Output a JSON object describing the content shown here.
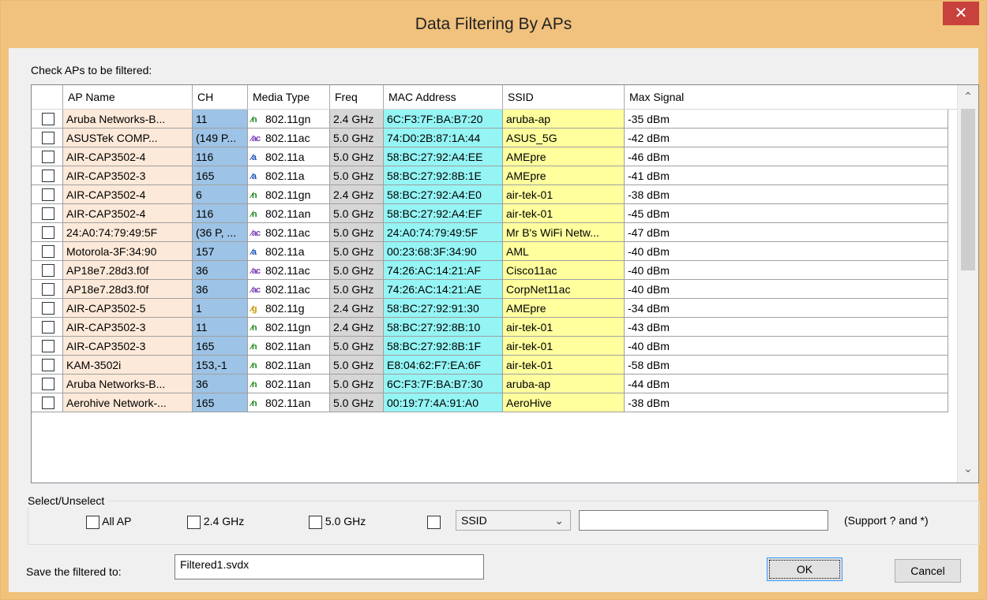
{
  "window": {
    "title": "Data Filtering By APs",
    "close_label": "✕"
  },
  "instructions": "Check APs to be filtered:",
  "columns": [
    "AP Name",
    "CH",
    "Media Type",
    "Freq",
    "MAC Address",
    "SSID",
    "Max Signal"
  ],
  "rows": [
    {
      "name": "Aruba Networks-B...",
      "ch": "11",
      "icon": "n",
      "media": "802.11gn",
      "freq": "2.4 GHz",
      "mac": "6C:F3:7F:BA:B7:20",
      "ssid": "aruba-ap",
      "max": "-35 dBm"
    },
    {
      "name": "ASUSTek COMP...",
      "ch": "(149 P...",
      "icon": "ac",
      "media": "802.11ac",
      "freq": "5.0 GHz",
      "mac": "74:D0:2B:87:1A:44",
      "ssid": "ASUS_5G",
      "max": "-42 dBm"
    },
    {
      "name": "AIR-CAP3502-4",
      "ch": "116",
      "icon": "a",
      "media": "802.11a",
      "freq": "5.0 GHz",
      "mac": "58:BC:27:92:A4:EE",
      "ssid": "AMEpre",
      "max": "-46 dBm"
    },
    {
      "name": "AIR-CAP3502-3",
      "ch": "165",
      "icon": "a",
      "media": "802.11a",
      "freq": "5.0 GHz",
      "mac": "58:BC:27:92:8B:1E",
      "ssid": "AMEpre",
      "max": "-41 dBm"
    },
    {
      "name": "AIR-CAP3502-4",
      "ch": "6",
      "icon": "n",
      "media": "802.11gn",
      "freq": "2.4 GHz",
      "mac": "58:BC:27:92:A4:E0",
      "ssid": "air-tek-01",
      "max": "-38 dBm"
    },
    {
      "name": "AIR-CAP3502-4",
      "ch": "116",
      "icon": "n",
      "media": "802.11an",
      "freq": "5.0 GHz",
      "mac": "58:BC:27:92:A4:EF",
      "ssid": "air-tek-01",
      "max": "-45 dBm"
    },
    {
      "name": "24:A0:74:79:49:5F",
      "ch": "(36 P, ...",
      "icon": "ac",
      "media": "802.11ac",
      "freq": "5.0 GHz",
      "mac": "24:A0:74:79:49:5F",
      "ssid": "Mr B's WiFi Netw...",
      "max": "-47 dBm"
    },
    {
      "name": "Motorola-3F:34:90",
      "ch": "157",
      "icon": "a",
      "media": "802.11a",
      "freq": "5.0 GHz",
      "mac": "00:23:68:3F:34:90",
      "ssid": "AML",
      "max": "-40 dBm"
    },
    {
      "name": "AP18e7.28d3.f0f",
      "ch": "36",
      "icon": "ac",
      "media": "802.11ac",
      "freq": "5.0 GHz",
      "mac": "74:26:AC:14:21:AF",
      "ssid": "Cisco11ac",
      "max": "-40 dBm"
    },
    {
      "name": "AP18e7.28d3.f0f",
      "ch": "36",
      "icon": "ac",
      "media": "802.11ac",
      "freq": "5.0 GHz",
      "mac": "74:26:AC:14:21:AE",
      "ssid": "CorpNet11ac",
      "max": "-40 dBm"
    },
    {
      "name": "AIR-CAP3502-5",
      "ch": "1",
      "icon": "g",
      "media": "802.11g",
      "freq": "2.4 GHz",
      "mac": "58:BC:27:92:91:30",
      "ssid": "AMEpre",
      "max": "-34 dBm"
    },
    {
      "name": "AIR-CAP3502-3",
      "ch": "11",
      "icon": "n",
      "media": "802.11gn",
      "freq": "2.4 GHz",
      "mac": "58:BC:27:92:8B:10",
      "ssid": "air-tek-01",
      "max": "-43 dBm"
    },
    {
      "name": "AIR-CAP3502-3",
      "ch": "165",
      "icon": "n",
      "media": "802.11an",
      "freq": "5.0 GHz",
      "mac": "58:BC:27:92:8B:1F",
      "ssid": "air-tek-01",
      "max": "-40 dBm"
    },
    {
      "name": "KAM-3502i",
      "ch": "153,-1",
      "icon": "n",
      "media": "802.11an",
      "freq": "5.0 GHz",
      "mac": "E8:04:62:F7:EA:6F",
      "ssid": "air-tek-01",
      "max": "-58 dBm"
    },
    {
      "name": "Aruba Networks-B...",
      "ch": "36",
      "icon": "n",
      "media": "802.11an",
      "freq": "5.0 GHz",
      "mac": "6C:F3:7F:BA:B7:30",
      "ssid": "aruba-ap",
      "max": "-44 dBm"
    },
    {
      "name": "Aerohive Network-...",
      "ch": "165",
      "icon": "n",
      "media": "802.11an",
      "freq": "5.0 GHz",
      "mac": "00:19:77:4A:91:A0",
      "ssid": "AeroHive",
      "max": "-38 dBm"
    }
  ],
  "icon_colors": {
    "n": "#1a8a1a",
    "ac": "#7a3db5",
    "a": "#1a4fb5",
    "g": "#c79a00"
  },
  "select_group": {
    "label": "Select/Unselect",
    "all_ap": "All AP",
    "ghz24": "2.4 GHz",
    "ghz50": "5.0 GHz",
    "field": "SSID",
    "hint": "(Support ? and *)"
  },
  "save": {
    "label": "Save the filtered to:",
    "value": "Filtered1.svdx"
  },
  "buttons": {
    "ok": "OK",
    "cancel": "Cancel"
  }
}
